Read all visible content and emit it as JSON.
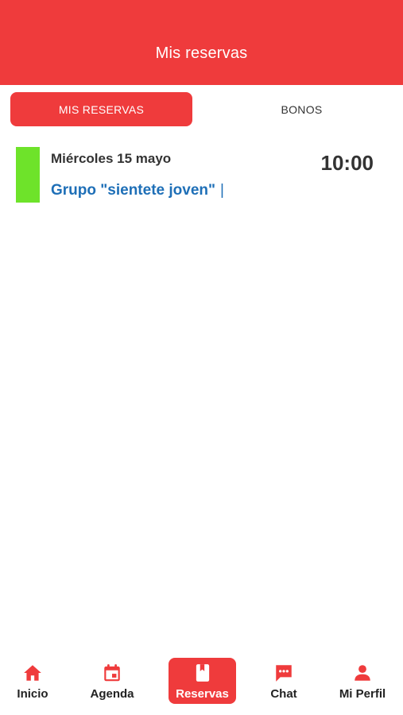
{
  "header": {
    "title": "Mis reservas"
  },
  "tabs": [
    {
      "label": "MIS RESERVAS",
      "active": true
    },
    {
      "label": "BONOS",
      "active": false
    }
  ],
  "reservations": [
    {
      "date": "Miércoles 15 mayo",
      "time": "10:00",
      "title": "Grupo \"sientete joven\"",
      "suffix": "|",
      "color": "#6ee32a"
    }
  ],
  "bottom_nav": {
    "items": [
      {
        "label": "Inicio",
        "icon": "home-icon",
        "active": false
      },
      {
        "label": "Agenda",
        "icon": "calendar-icon",
        "active": false
      },
      {
        "label": "Reservas",
        "icon": "bookmark-book-icon",
        "active": true
      },
      {
        "label": "Chat",
        "icon": "chat-bubble-icon",
        "active": false
      },
      {
        "label": "Mi Perfil",
        "icon": "person-icon",
        "active": false
      }
    ]
  },
  "colors": {
    "brand_red": "#ef3b3c",
    "link_blue": "#1e6fb7",
    "status_green": "#6ee32a"
  }
}
